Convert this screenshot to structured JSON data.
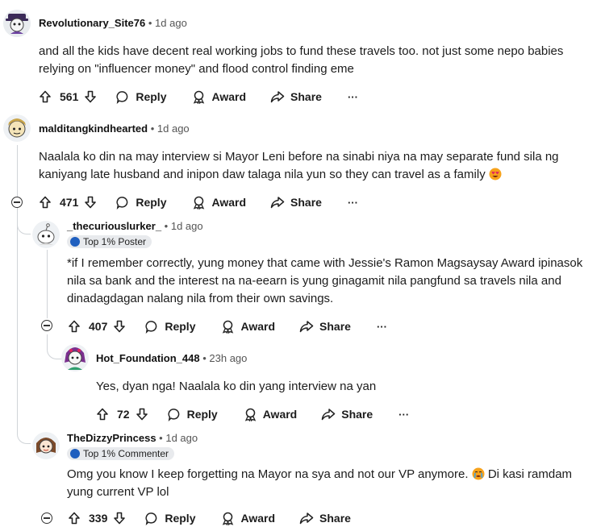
{
  "comments": [
    {
      "username": "Revolutionary_Site76",
      "age": "1d ago",
      "text": "and all the kids have decent real working jobs to fund these travels too. not just some nepo babies relying on \"influencer money\" and flood control finding eme",
      "votes": "561"
    },
    {
      "username": "malditangkindhearted",
      "age": "1d ago",
      "text": "Naalala ko din na may interview si Mayor Leni before na sinabi niya na may separate fund sila ng kaniyang late husband and inipon daw talaga nila yun so they can travel as a family",
      "votes": "471"
    },
    {
      "username": "_thecuriouslurker_",
      "age": "1d ago",
      "flair": "Top 1% Poster",
      "text": "*if I remember correctly, yung money that came with Jessie's Ramon Magsaysay Award ipinasok nila sa bank and the interest na na-eearn is yung ginagamit nila pangfund sa travels nila and dinadagdagan nalang nila from their own savings.",
      "votes": "407"
    },
    {
      "username": "Hot_Foundation_448",
      "age": "23h ago",
      "text": "Yes, dyan nga! Naalala ko din yang interview na yan",
      "votes": "72"
    },
    {
      "username": "TheDizzyPrincess",
      "age": "1d ago",
      "flair": "Top 1% Commenter",
      "text_a": "Omg you know I keep forgetting na Mayor na sya and not our VP anymore.",
      "text_b": "Di kasi ramdam yung current VP lol",
      "votes": "339"
    }
  ],
  "labels": {
    "sep": "•",
    "reply": "Reply",
    "award": "Award",
    "share": "Share",
    "more": "···"
  },
  "colors": {
    "thread": "#d0d4d8",
    "flair_bg": "#e8eaed"
  }
}
